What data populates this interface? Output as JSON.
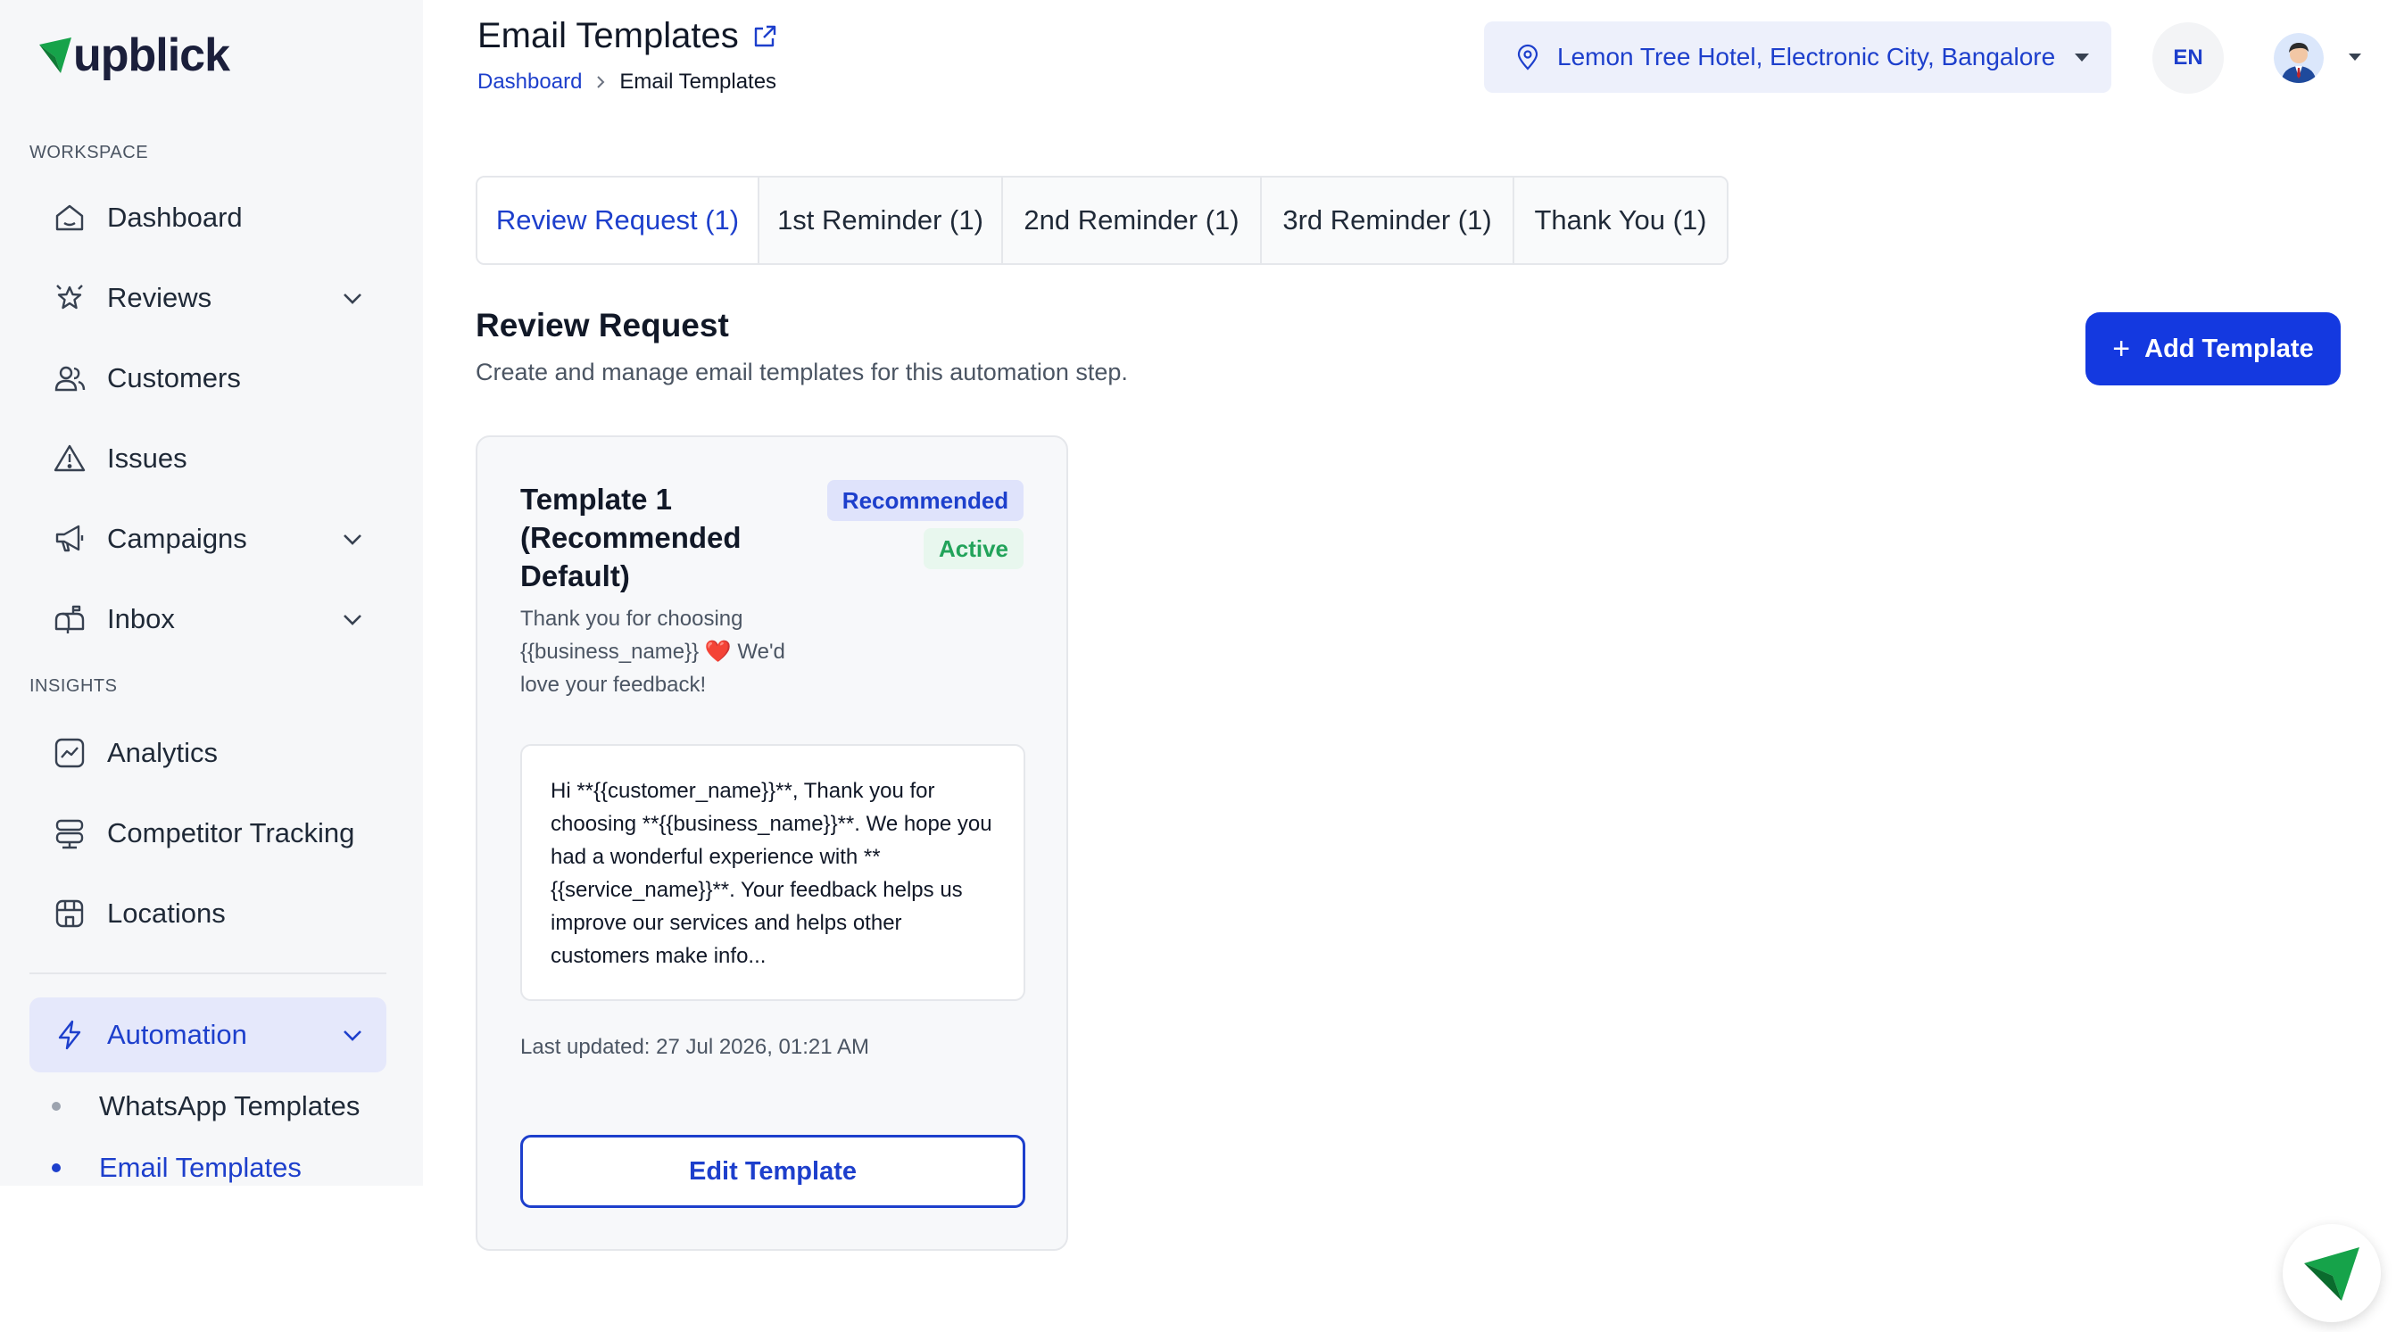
{
  "brand": {
    "name": "upblick",
    "accent": "#1d3fcc",
    "logo_green": "#16a34a"
  },
  "sidebar": {
    "workspace_label": "WORKSPACE",
    "insights_label": "INSIGHTS",
    "items": [
      {
        "label": "Dashboard",
        "icon": "home-icon"
      },
      {
        "label": "Reviews",
        "icon": "star-icon"
      },
      {
        "label": "Customers",
        "icon": "users-icon"
      },
      {
        "label": "Issues",
        "icon": "warning-icon"
      },
      {
        "label": "Campaigns",
        "icon": "megaphone-icon"
      },
      {
        "label": "Inbox",
        "icon": "mailbox-icon"
      },
      {
        "label": "Analytics",
        "icon": "chart-icon"
      },
      {
        "label": "Competitor Tracking",
        "icon": "server-icon"
      },
      {
        "label": "Locations",
        "icon": "store-icon"
      },
      {
        "label": "Automation",
        "icon": "bolt-icon"
      }
    ],
    "sub_items": [
      {
        "label": "WhatsApp Templates"
      },
      {
        "label": "Email Templates"
      }
    ]
  },
  "header": {
    "title": "Email Templates",
    "breadcrumb": [
      "Dashboard",
      "Email Templates"
    ],
    "location": "Lemon Tree Hotel, Electronic City, Bangalore",
    "language": "EN"
  },
  "tabs": [
    {
      "label": "Review Request (1)"
    },
    {
      "label": "1st Reminder (1)"
    },
    {
      "label": "2nd Reminder (1)"
    },
    {
      "label": "3rd Reminder (1)"
    },
    {
      "label": "Thank You (1)"
    }
  ],
  "section": {
    "title": "Review Request",
    "subtitle": "Create and manage email templates for this automation step.",
    "add_button": "Add Template"
  },
  "card": {
    "title": "Template 1 (Recommended Default)",
    "badge_recommended": "Recommended",
    "badge_active": "Active",
    "description_before": "Thank you for choosing {{business_name}} ",
    "description_emoji": "❤️",
    "description_after": " We'd love your feedback!",
    "body": "Hi **{{customer_name}}**, Thank you for choosing **{{business_name}}**. We hope you had a wonderful experience with **{{service_name}}**. Your feedback helps us improve our services and helps other customers make info...",
    "last_updated": "Last updated: 27 Jul 2026, 01:21 AM",
    "edit_button": "Edit Template"
  }
}
